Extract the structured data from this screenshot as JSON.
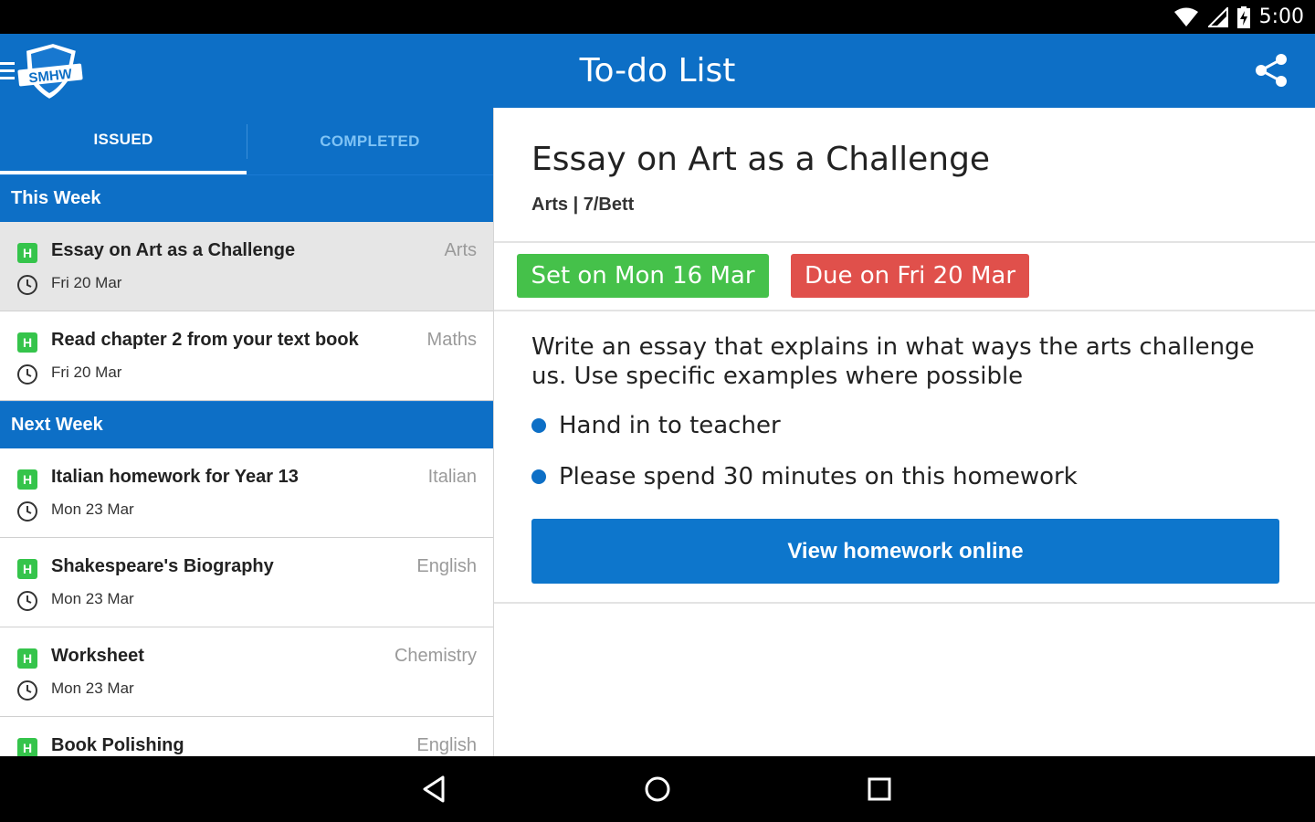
{
  "status_bar": {
    "time": "5:00"
  },
  "app_bar": {
    "title": "To-do List",
    "logo_text": "SMHW"
  },
  "tabs": [
    {
      "label": "ISSUED",
      "active": true
    },
    {
      "label": "COMPLETED",
      "active": false
    }
  ],
  "sections": [
    {
      "header": "This Week",
      "tasks": [
        {
          "badge": "H",
          "title": "Essay on Art as a Challenge",
          "subject": "Arts",
          "date": "Fri 20 Mar",
          "selected": true
        },
        {
          "badge": "H",
          "title": "Read chapter 2 from your text book",
          "subject": "Maths",
          "date": "Fri 20 Mar",
          "selected": false
        }
      ]
    },
    {
      "header": "Next Week",
      "tasks": [
        {
          "badge": "H",
          "title": "Italian homework for Year 13",
          "subject": "Italian",
          "date": "Mon 23 Mar",
          "selected": false
        },
        {
          "badge": "H",
          "title": "Shakespeare's Biography",
          "subject": "English",
          "date": "Mon 23 Mar",
          "selected": false
        },
        {
          "badge": "H",
          "title": "Worksheet",
          "subject": "Chemistry",
          "date": "Mon 23 Mar",
          "selected": false
        },
        {
          "badge": "H",
          "title": "Book Polishing",
          "subject": "English",
          "date": "",
          "selected": false
        }
      ]
    }
  ],
  "detail": {
    "title": "Essay on Art as a Challenge",
    "subtitle": "Arts | 7/Bett",
    "set_on": "Set on Mon 16 Mar",
    "due_on": "Due on Fri 20 Mar",
    "description": "Write an essay that explains in what ways the arts challenge us. Use specific examples where possible",
    "bullets": [
      "Hand in to teacher",
      "Please spend 30 minutes on this homework"
    ],
    "button_label": "View homework online"
  },
  "colors": {
    "primary": "#0d6fc6",
    "badge_green": "#35c44b",
    "set_green": "#45c14a",
    "due_red": "#e0504b"
  },
  "icons": [
    "wifi-icon",
    "signal-icon",
    "battery-charging-icon",
    "menu-icon",
    "share-icon",
    "clock-icon",
    "back-icon",
    "home-icon",
    "recents-icon"
  ]
}
